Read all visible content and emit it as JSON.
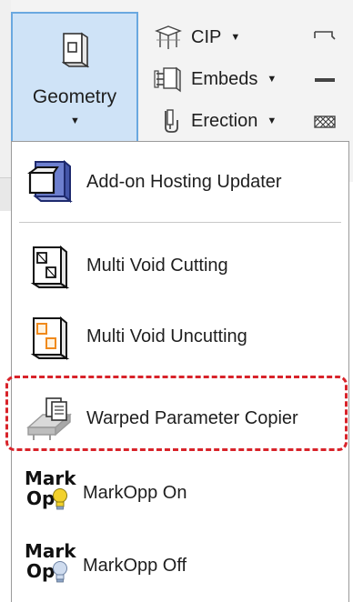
{
  "ribbon": {
    "geometry": {
      "label": "Geometry",
      "icon": "geometry-box-icon"
    },
    "rows": [
      {
        "label": "CIP",
        "icon": "cip-icon",
        "has_dropdown": true
      },
      {
        "label": "Embeds",
        "icon": "embeds-icon",
        "has_dropdown": true
      },
      {
        "label": "Erection",
        "icon": "erection-icon",
        "has_dropdown": true
      }
    ],
    "accent_color": "#cfe3f7",
    "accent_border": "#6aa8e0"
  },
  "menu": {
    "items": [
      {
        "label": "Add-on Hosting Updater",
        "icon": "hosting-updater-icon"
      },
      {
        "label": "Multi Void Cutting",
        "icon": "multi-void-cutting-icon"
      },
      {
        "label": "Multi Void Uncutting",
        "icon": "multi-void-uncutting-icon"
      },
      {
        "label": "Warped Parameter Copier",
        "icon": "warped-parameter-copier-icon",
        "highlighted": true
      },
      {
        "label": "MarkOpp On",
        "icon": "markopp-on-icon",
        "icon_text_top": "Mark",
        "icon_text_bottom": "Op"
      },
      {
        "label": "MarkOpp Off",
        "icon": "markopp-off-icon",
        "icon_text_top": "Mark",
        "icon_text_bottom": "Op"
      }
    ],
    "highlight_color": "#d8232a"
  }
}
